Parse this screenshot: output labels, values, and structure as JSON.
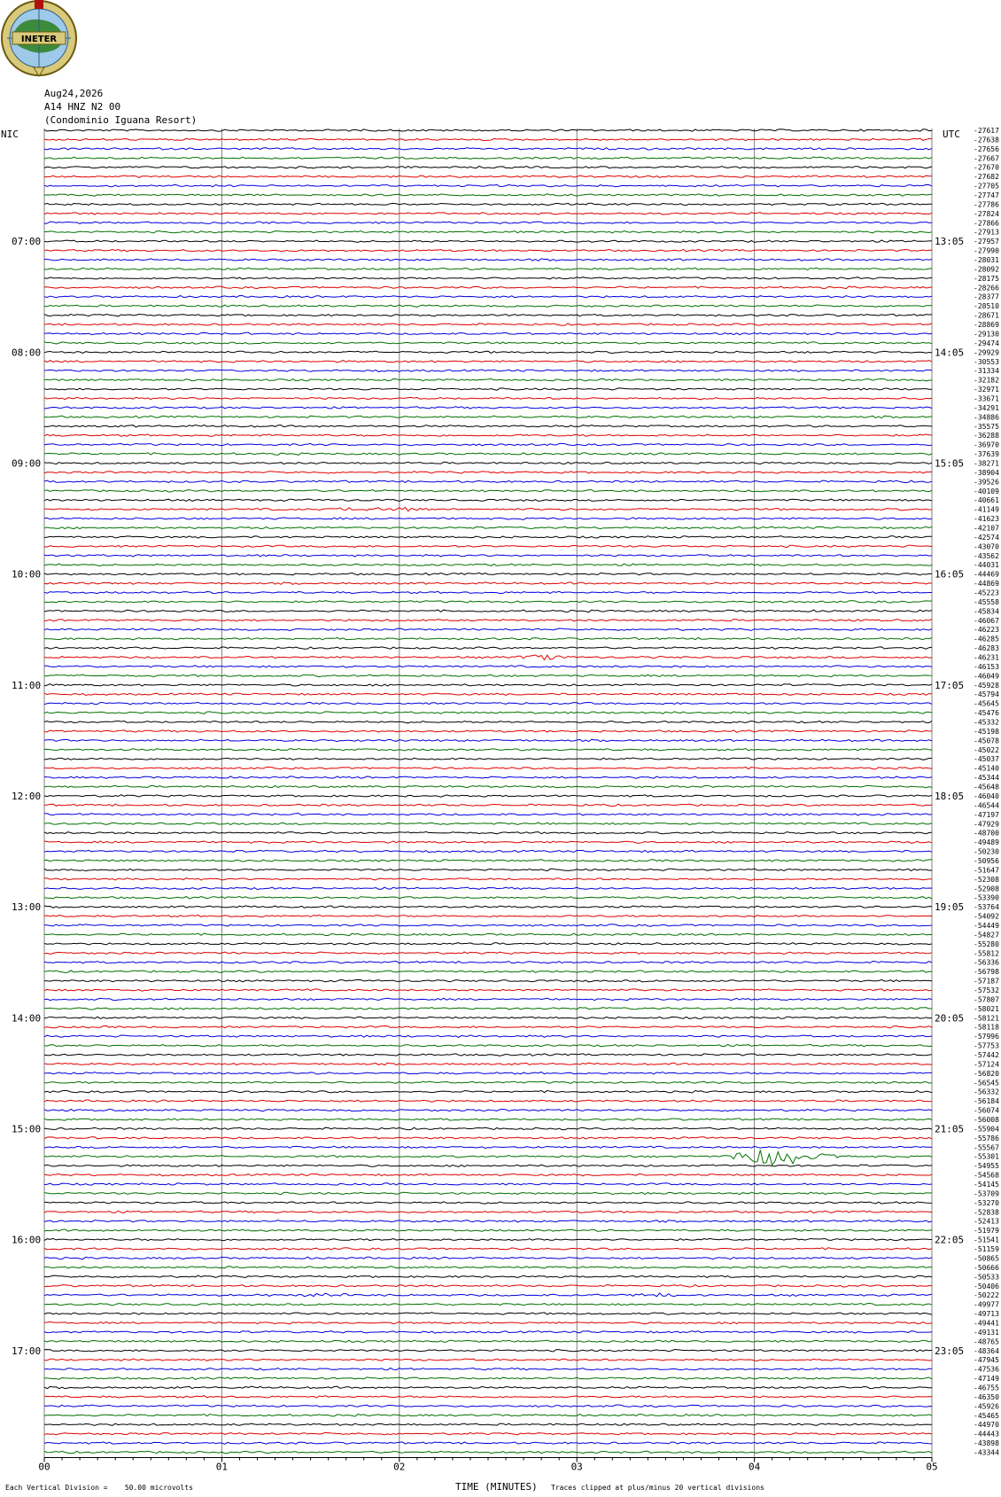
{
  "header": {
    "logo_text": "INETER",
    "date": "Aug24,2026",
    "station": "A14 HNZ N2 00",
    "site": "(Condominio Iguana Resort)",
    "left_zone": "NIC",
    "right_zone": "UTC"
  },
  "footer": {
    "scale_note": "Each Vertical Division =    50.00 microvolts",
    "clip_note": "Traces clipped at plus/minus 20 vertical divisions"
  },
  "colors": {
    "black": "#000000",
    "red": "#e00000",
    "blue": "#0000e0",
    "green": "#007000",
    "grid": "#808080"
  },
  "chart_data": {
    "type": "line",
    "title": "",
    "xlabel": "TIME (MINUTES)",
    "ylabel": "",
    "xlim": [
      0,
      5
    ],
    "x_ticks": [
      "00",
      "01",
      "02",
      "03",
      "04",
      "05"
    ],
    "trace_color_cycle": [
      "black",
      "red",
      "blue",
      "green"
    ],
    "left_time_labels": [
      {
        "trace": 12,
        "label": "07:00"
      },
      {
        "trace": 24,
        "label": "08:00"
      },
      {
        "trace": 36,
        "label": "09:00"
      },
      {
        "trace": 48,
        "label": "10:00"
      },
      {
        "trace": 60,
        "label": "11:00"
      },
      {
        "trace": 72,
        "label": "12:00"
      },
      {
        "trace": 84,
        "label": "13:00"
      },
      {
        "trace": 96,
        "label": "14:00"
      },
      {
        "trace": 108,
        "label": "15:00"
      },
      {
        "trace": 120,
        "label": "16:00"
      },
      {
        "trace": 132,
        "label": "17:00"
      }
    ],
    "right_time_labels": [
      {
        "trace": 12,
        "label": "13:05"
      },
      {
        "trace": 24,
        "label": "14:05"
      },
      {
        "trace": 36,
        "label": "15:05"
      },
      {
        "trace": 48,
        "label": "16:05"
      },
      {
        "trace": 60,
        "label": "17:05"
      },
      {
        "trace": 72,
        "label": "18:05"
      },
      {
        "trace": 84,
        "label": "19:05"
      },
      {
        "trace": 96,
        "label": "20:05"
      },
      {
        "trace": 108,
        "label": "21:05"
      },
      {
        "trace": 120,
        "label": "22:05"
      },
      {
        "trace": 132,
        "label": "23:05"
      }
    ],
    "trace_offsets": [
      "-27617",
      "-27638",
      "-27656",
      "-27667",
      "-27670",
      "-27682",
      "-27705",
      "-27747",
      "-27786",
      "-27824",
      "-27866",
      "-27913",
      "-27957",
      "-27990",
      "-28031",
      "-28092",
      "-28175",
      "-28266",
      "-28377",
      "-28510",
      "-28671",
      "-28869",
      "-29130",
      "-29474",
      "-29929",
      "-30553",
      "-31334",
      "-32182",
      "-32971",
      "-33671",
      "-34291",
      "-34886",
      "-35575",
      "-36288",
      "-36970",
      "-37639",
      "-38271",
      "-38904",
      "-39526",
      "-40109",
      "-40661",
      "-41149",
      "-41623",
      "-42107",
      "-42574",
      "-43070",
      "-43562",
      "-44031",
      "-44469",
      "-44869",
      "-45223",
      "-45558",
      "-45834",
      "-46067",
      "-46223",
      "-46285",
      "-46283",
      "-46231",
      "-46153",
      "-46049",
      "-45928",
      "-45794",
      "-45645",
      "-45476",
      "-45332",
      "-45198",
      "-45078",
      "-45022",
      "-45037",
      "-45140",
      "-45344",
      "-45648",
      "-46040",
      "-46544",
      "-47197",
      "-47929",
      "-48700",
      "-49489",
      "-50230",
      "-50956",
      "-51647",
      "-52308",
      "-52908",
      "-53390",
      "-53764",
      "-54092",
      "-54449",
      "-54827",
      "-55280",
      "-55812",
      "-56336",
      "-56798",
      "-57187",
      "-57532",
      "-57807",
      "-58021",
      "-58121",
      "-58118",
      "-57996",
      "-57753",
      "-57442",
      "-57124",
      "-56820",
      "-56545",
      "-56332",
      "-56184",
      "-56074",
      "-56008",
      "-55904",
      "-55786",
      "-55567",
      "-55301",
      "-54955",
      "-54568",
      "-54145",
      "-53709",
      "-53270",
      "-52838",
      "-52413",
      "-51979",
      "-51541",
      "-51159",
      "-50865",
      "-50666",
      "-50533",
      "-50406",
      "-50222",
      "-49977",
      "-49713",
      "-49441",
      "-49131",
      "-48765",
      "-48364",
      "-47945",
      "-47536",
      "-47149",
      "-46755",
      "-46350",
      "-45926",
      "-45465",
      "-44970",
      "-44443",
      "-43898",
      "-43344"
    ],
    "events": [
      {
        "trace": 41,
        "x": 1.9,
        "amplitude": 0.9,
        "width": 0.3
      },
      {
        "trace": 57,
        "x": 2.8,
        "amplitude": 0.8,
        "width": 0.2
      },
      {
        "trace": 111,
        "x": 4.15,
        "amplitude": 4.5,
        "width": 0.35
      },
      {
        "trace": 126,
        "x": 1.6,
        "amplitude": 0.6,
        "width": 0.2
      },
      {
        "trace": 126,
        "x": 3.45,
        "amplitude": 0.6,
        "width": 0.2
      }
    ]
  }
}
